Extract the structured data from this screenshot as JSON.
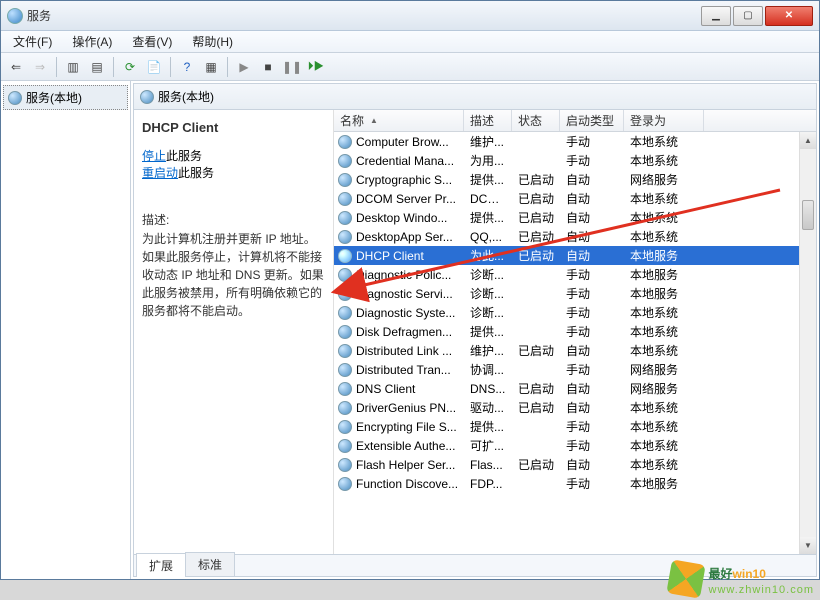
{
  "window": {
    "title": "服务"
  },
  "menu": {
    "file": "文件(F)",
    "action": "操作(A)",
    "view": "查看(V)",
    "help": "帮助(H)"
  },
  "tree": {
    "root": "服务(本地)"
  },
  "panel_title": "服务(本地)",
  "detail": {
    "name": "DHCP Client",
    "stop_link": "停止",
    "stop_suffix": "此服务",
    "restart_link": "重启动",
    "restart_suffix": "此服务",
    "desc_label": "描述:",
    "desc": "为此计算机注册并更新 IP 地址。如果此服务停止，计算机将不能接收动态 IP 地址和 DNS 更新。如果此服务被禁用，所有明确依赖它的服务都将不能启动。"
  },
  "columns": {
    "name": "名称",
    "desc": "描述",
    "status": "状态",
    "start": "启动类型",
    "logon": "登录为"
  },
  "rows": [
    {
      "name": "Computer Brow...",
      "desc": "维护...",
      "status": "",
      "start": "手动",
      "logon": "本地系统"
    },
    {
      "name": "Credential Mana...",
      "desc": "为用...",
      "status": "",
      "start": "手动",
      "logon": "本地系统"
    },
    {
      "name": "Cryptographic S...",
      "desc": "提供...",
      "status": "已启动",
      "start": "自动",
      "logon": "网络服务"
    },
    {
      "name": "DCOM Server Pr...",
      "desc": "DCO...",
      "status": "已启动",
      "start": "自动",
      "logon": "本地系统"
    },
    {
      "name": "Desktop Windo...",
      "desc": "提供...",
      "status": "已启动",
      "start": "自动",
      "logon": "本地系统"
    },
    {
      "name": "DesktopApp Ser...",
      "desc": "QQ,...",
      "status": "已启动",
      "start": "自动",
      "logon": "本地系统"
    },
    {
      "name": "DHCP Client",
      "desc": "为此...",
      "status": "已启动",
      "start": "自动",
      "logon": "本地服务",
      "selected": true
    },
    {
      "name": "Diagnostic Polic...",
      "desc": "诊断...",
      "status": "",
      "start": "手动",
      "logon": "本地服务"
    },
    {
      "name": "Diagnostic Servi...",
      "desc": "诊断...",
      "status": "",
      "start": "手动",
      "logon": "本地服务"
    },
    {
      "name": "Diagnostic Syste...",
      "desc": "诊断...",
      "status": "",
      "start": "手动",
      "logon": "本地系统"
    },
    {
      "name": "Disk Defragmen...",
      "desc": "提供...",
      "status": "",
      "start": "手动",
      "logon": "本地系统"
    },
    {
      "name": "Distributed Link ...",
      "desc": "维护...",
      "status": "已启动",
      "start": "自动",
      "logon": "本地系统"
    },
    {
      "name": "Distributed Tran...",
      "desc": "协调...",
      "status": "",
      "start": "手动",
      "logon": "网络服务"
    },
    {
      "name": "DNS Client",
      "desc": "DNS...",
      "status": "已启动",
      "start": "自动",
      "logon": "网络服务"
    },
    {
      "name": "DriverGenius PN...",
      "desc": "驱动...",
      "status": "已启动",
      "start": "自动",
      "logon": "本地系统"
    },
    {
      "name": "Encrypting File S...",
      "desc": "提供...",
      "status": "",
      "start": "手动",
      "logon": "本地系统"
    },
    {
      "name": "Extensible Authe...",
      "desc": "可扩...",
      "status": "",
      "start": "手动",
      "logon": "本地系统"
    },
    {
      "name": "Flash Helper Ser...",
      "desc": "Flas...",
      "status": "已启动",
      "start": "自动",
      "logon": "本地系统"
    },
    {
      "name": "Function Discove...",
      "desc": "FDP...",
      "status": "",
      "start": "手动",
      "logon": "本地服务"
    }
  ],
  "tabs": {
    "ext": "扩展",
    "std": "标准"
  },
  "watermark": {
    "brand_a": "最好",
    "brand_b": "win10",
    "url": "www.zhwin10.com"
  }
}
